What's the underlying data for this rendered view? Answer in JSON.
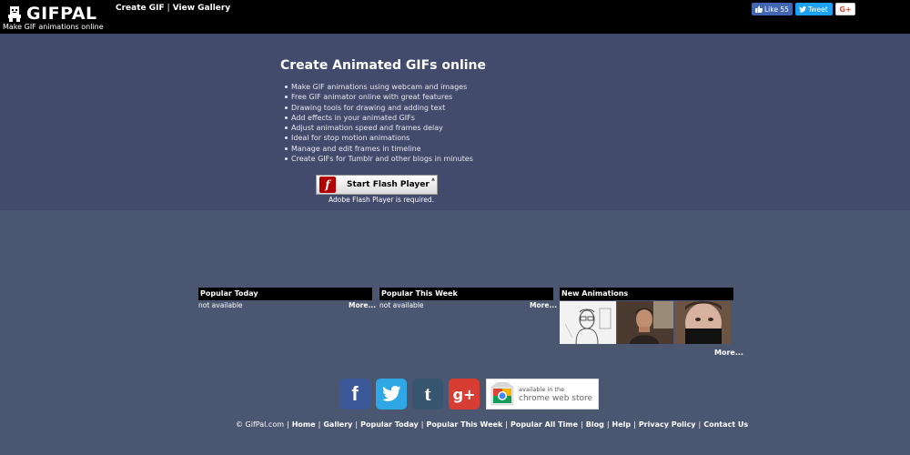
{
  "header": {
    "logo_text": "GIFPAL",
    "tagline": "Make GIF animations online",
    "nav": [
      {
        "label": "Create GIF"
      },
      {
        "label": "View Gallery"
      }
    ],
    "nav_separator": "|",
    "social": {
      "like_label": "Like 55",
      "tweet_label": "Tweet",
      "gplus_label": "G+"
    }
  },
  "hero": {
    "title": "Create Animated GIFs online",
    "features": [
      "Make GIF animations using webcam and images",
      "Free GIF animator online with great features",
      "Drawing tools for drawing and adding text",
      "Add effects in your animated GIFs",
      "Adjust animation speed and frames delay",
      "Ideal for stop motion animations",
      "Manage and edit frames in timeline",
      "Create GIFs for Tumblr and other blogs in minutes"
    ],
    "flash_button_label": "Start Flash Player",
    "flash_note": "Adobe Flash Player is required."
  },
  "panels": [
    {
      "title": "Popular Today",
      "status": "not available",
      "more": "More..."
    },
    {
      "title": "Popular This Week",
      "status": "not available",
      "more": "More..."
    },
    {
      "title": "New Animations",
      "more": "More..."
    }
  ],
  "chrome_store": {
    "line1": "available in the",
    "line2": "chrome web store"
  },
  "footer": {
    "copyright": "© GifPal.com",
    "links": [
      "Home",
      "Gallery",
      "Popular Today",
      "Popular This Week",
      "Popular All Time",
      "Blog",
      "Help",
      "Privacy Policy",
      "Contact Us"
    ],
    "separator": "|"
  },
  "colors": {
    "header_bg": "#000000",
    "hero_bg": "#424b6c",
    "page_bg": "#4b5671",
    "facebook": "#3b5998",
    "twitter": "#2fa7e4",
    "tumblr": "#37556f",
    "gplus": "#d73d32",
    "flash_red": "#b30000"
  },
  "icons": [
    "gifpal-logo-icon",
    "facebook-like-icon",
    "twitter-bird-icon",
    "google-plus-icon",
    "flash-player-icon",
    "facebook-icon",
    "twitter-icon",
    "tumblr-icon",
    "google-plus-big-icon",
    "chrome-web-store-icon"
  ]
}
